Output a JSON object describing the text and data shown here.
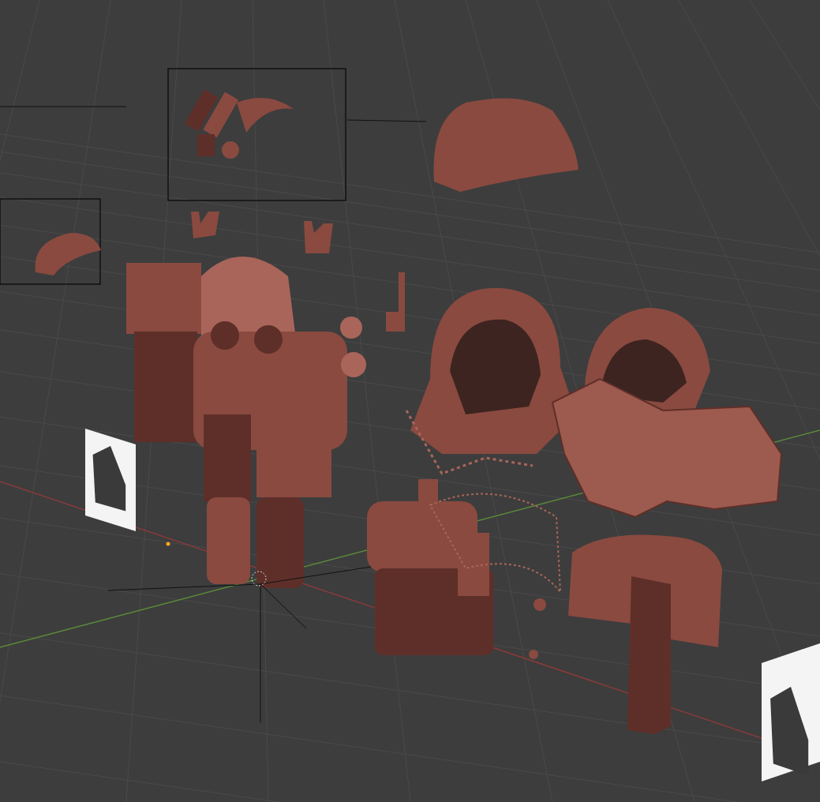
{
  "viewport": {
    "grid": true,
    "axes": true,
    "reference_images": [
      {
        "kind": "photo"
      },
      {
        "kind": "photo"
      }
    ]
  }
}
